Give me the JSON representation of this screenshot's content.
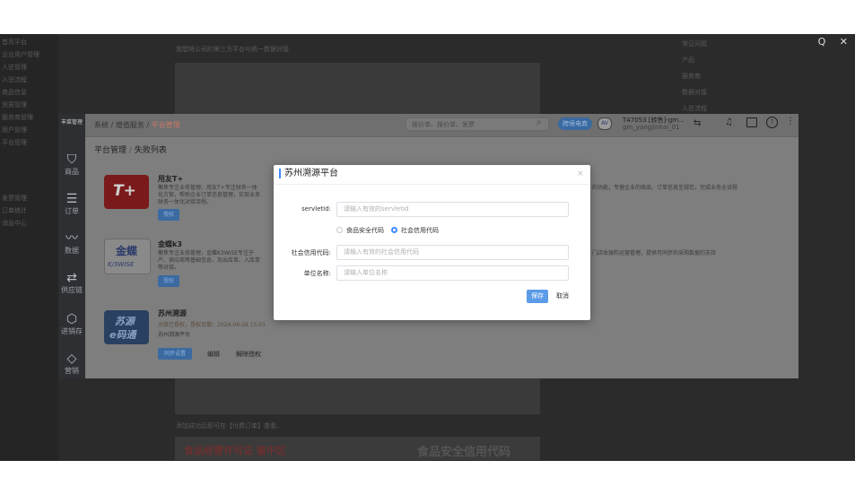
{
  "topbar": {
    "tools_icons": [
      "search-icon",
      "close-icon"
    ],
    "search_glyph": "Q",
    "close_glyph": "✕"
  },
  "background_page": {
    "sidebar_lines": [
      "首页平台",
      "企业用户管理",
      "入驻管理",
      "入驻流程",
      "商品信息",
      "资质管理",
      "服务商管理",
      "用户管理",
      "平台管理",
      "发票管理",
      "订单统计",
      "消息中心"
    ],
    "intro_text": "我想将公司的第三方平台与统一数据对接",
    "right_lines": [
      "常见问题",
      "产品",
      "服务商",
      "数据对接",
      "入驻流程"
    ],
    "bottom_note": "添加成功后即可在【付费订单】查看。",
    "banner_left": "食品经营许可证 鉴中区",
    "banner_right": "食品安全信用代码"
  },
  "app": {
    "logo": "丰菜管理",
    "nav": [
      {
        "label": "商品",
        "icon": "bag-icon",
        "glyph": "⛉"
      },
      {
        "label": "订单",
        "icon": "order-icon",
        "glyph": "☰"
      },
      {
        "label": "数据",
        "icon": "chart-icon",
        "glyph": "〰"
      },
      {
        "label": "供应链",
        "icon": "supply-icon",
        "glyph": "⇄"
      },
      {
        "label": "进销存",
        "icon": "inventory-icon",
        "glyph": "⬡"
      },
      {
        "label": "营销",
        "icon": "tag-icon",
        "glyph": "◇"
      }
    ],
    "breadcrumb": {
      "a": "系统",
      "sep": "/",
      "b": "增值服务",
      "c": "平台管理"
    },
    "search_placeholder": "报价单、报价单、发票",
    "pill_label": "跨境电商",
    "user": {
      "name": "T47053 [转售]-gm...",
      "sub": "gm_yangjinhai_01"
    },
    "header_icons": [
      "swap-icon",
      "bell-icon",
      "message-icon",
      "help-icon",
      "more-icon"
    ],
    "tabs": {
      "t1": "平台管理",
      "sep": "/",
      "t2": "失败列表"
    },
    "items": [
      {
        "title": "用友T+",
        "logo_text": "T+",
        "desc": "聚焦专注业务管理、用友T+专注财务一体化方案，帮助企业订单信息管理，实现业务财务一体化对接流程。",
        "button": "授权"
      },
      {
        "title": "金蝶k3",
        "logo_text": "金蝶",
        "logo_sub": "K/3WISE",
        "desc": "聚焦专注业务管理，金蝶K3WISE专注于产、供应商等基础信息，及出库单、入库单等对接。",
        "button": "授权"
      },
      {
        "title": "苏州溯源",
        "logo_text": "苏源",
        "logo_sub": "e码通",
        "status": "对接已授权，授权日期：2024-08-29 15:01",
        "sub": "苏州溯源平台",
        "btn1": "同步设置",
        "btn2": "编辑",
        "btn3": "解除授权"
      }
    ],
    "right_desc_1": "的功能，专营企业的商品、订单信息至规范，完成业务全流程",
    "right_desc_2": "门店收银和运营管理，提供可同步的采购数据的支持"
  },
  "modal": {
    "title": "苏州溯源平台",
    "close": "×",
    "fields": {
      "servlet_label": "servletId:",
      "servlet_placeholder": "请输入有效的servletId",
      "radio_food": "食品安全代码",
      "radio_social": "社会信用代码",
      "social_label": "社会信用代码:",
      "social_placeholder": "请输入有效的社会信用代码",
      "unit_label": "单位名称:",
      "unit_placeholder": "请输入单位名称"
    },
    "radio_selected": "social",
    "save": "保存",
    "cancel": "取消"
  }
}
